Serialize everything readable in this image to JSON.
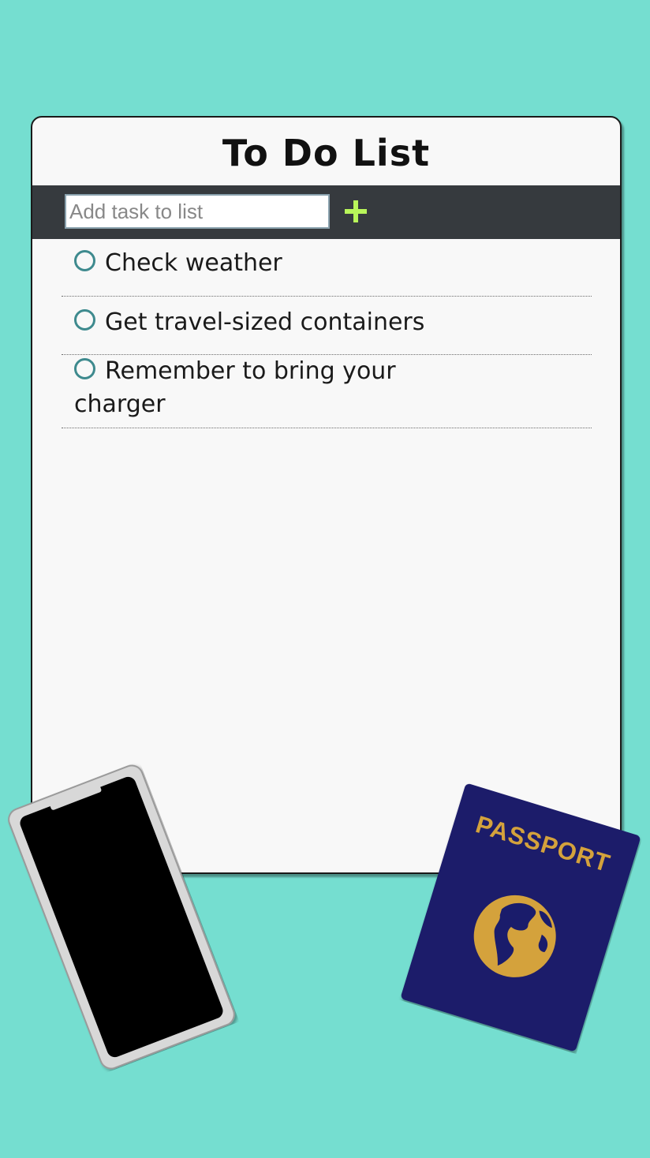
{
  "app": {
    "title": "To Do List"
  },
  "input": {
    "placeholder": "Add task to list",
    "value": ""
  },
  "add_button": {
    "icon": "plus-icon",
    "color": "#b8f55a"
  },
  "tasks": [
    {
      "label": "Check weather",
      "done": false
    },
    {
      "label": "Get travel-sized containers",
      "done": false
    },
    {
      "label": "Remember to bring your charger",
      "done": false
    }
  ],
  "decor": {
    "passport_label": "PASSPORT",
    "passport_color": "#1a1c6b",
    "passport_accent": "#d4a23c",
    "background_color": "#75ded0"
  }
}
